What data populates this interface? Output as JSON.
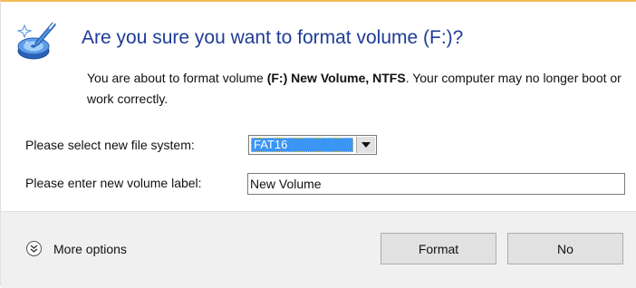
{
  "dialog": {
    "title": "Are you sure you want to format volume (F:)?",
    "warning": {
      "prefix": "You are about to format volume ",
      "volume_name": "(F:) New Volume, NTFS",
      "suffix": ". Your computer may no longer boot or work correctly."
    },
    "icon": "format-disk-wand-icon"
  },
  "form": {
    "file_system_label": "Please select new file system:",
    "file_system_value": "FAT16",
    "volume_label_label": "Please enter new volume label:",
    "volume_label_value": "New Volume"
  },
  "footer": {
    "more_options_label": "More options",
    "more_options_icon": "double-chevron-down-icon",
    "format_button": "Format",
    "no_button": "No"
  },
  "colors": {
    "title": "#1e3c96",
    "selection": "#3a95f5",
    "footer_bg": "#f0f0f0",
    "button_bg": "#e1e1e1",
    "top_border": "#f3ba55"
  }
}
